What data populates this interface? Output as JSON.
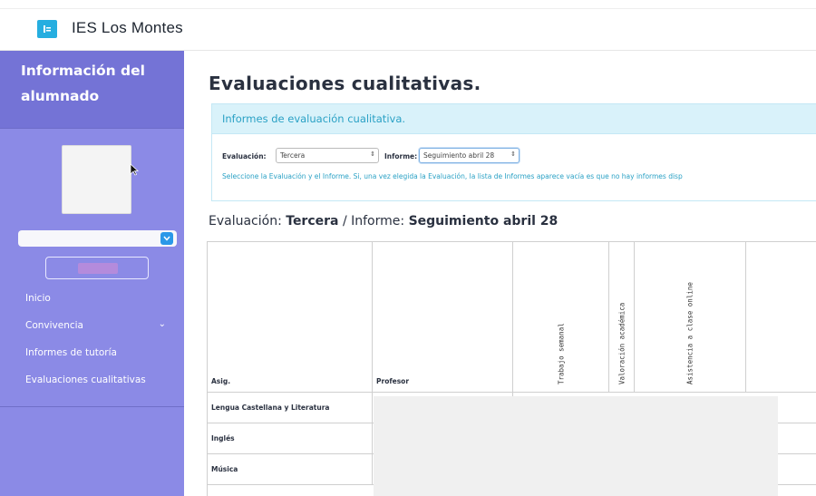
{
  "header": {
    "app_title": "IES Los Montes",
    "logo_icon": "school-logo-icon"
  },
  "sidebar": {
    "title": "Información del alumnado",
    "items": [
      {
        "label": "Inicio"
      },
      {
        "label": "Convivencia",
        "has_submenu": true
      },
      {
        "label": "Informes de tutoría"
      },
      {
        "label": "Evaluaciones cualitativas"
      }
    ]
  },
  "main": {
    "title": "Evaluaciones cualitativas.",
    "panel_title": "Informes de evaluación cualitativa.",
    "form": {
      "evaluacion_label": "Evaluación:",
      "evaluacion_value": "Tercera",
      "informe_label": "Informe:",
      "informe_value": "Seguimiento abril 28",
      "hint": "Seleccione la Evaluación y el Informe. Si, una vez elegida la Evaluación, la lista de Informes aparece vacía es que no hay informes disp"
    },
    "subtitle": {
      "eval_prefix": "Evaluación:",
      "eval_value": "Tercera",
      "sep": "/",
      "informe_prefix": "Informe:",
      "informe_value": "Seguimiento abril 28"
    },
    "table": {
      "headers": [
        "Asig.",
        "Profesor",
        "Trabajo semanal",
        "Valoración académica",
        "Asistencia a clase online"
      ],
      "rows": [
        "Lengua Castellana y Literatura",
        "Inglés",
        "Música"
      ]
    }
  },
  "colors": {
    "sidebar": "#8b8ae6",
    "sidebar_header": "#7473d6",
    "accent": "#26aee0",
    "panel_bg": "#d9f2fa",
    "panel_text": "#2aa1c5"
  }
}
